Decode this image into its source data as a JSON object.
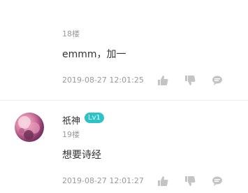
{
  "comments": [
    {
      "floor": "18楼",
      "content": "emmm，加一",
      "time": "2019-08-27 12:01:25"
    },
    {
      "username": "祇神",
      "level": "Lv1",
      "floor": "19楼",
      "content": "想要诗经",
      "time": "2019-08-27 12:01:27"
    }
  ],
  "icons": {
    "like": "thumbs-up-icon",
    "dislike": "thumbs-down-icon",
    "reply": "comment-bubble-icon"
  },
  "colors": {
    "meta_text": "#999999",
    "icon": "#c4c4c4",
    "level_badge": "#29c3c8"
  }
}
